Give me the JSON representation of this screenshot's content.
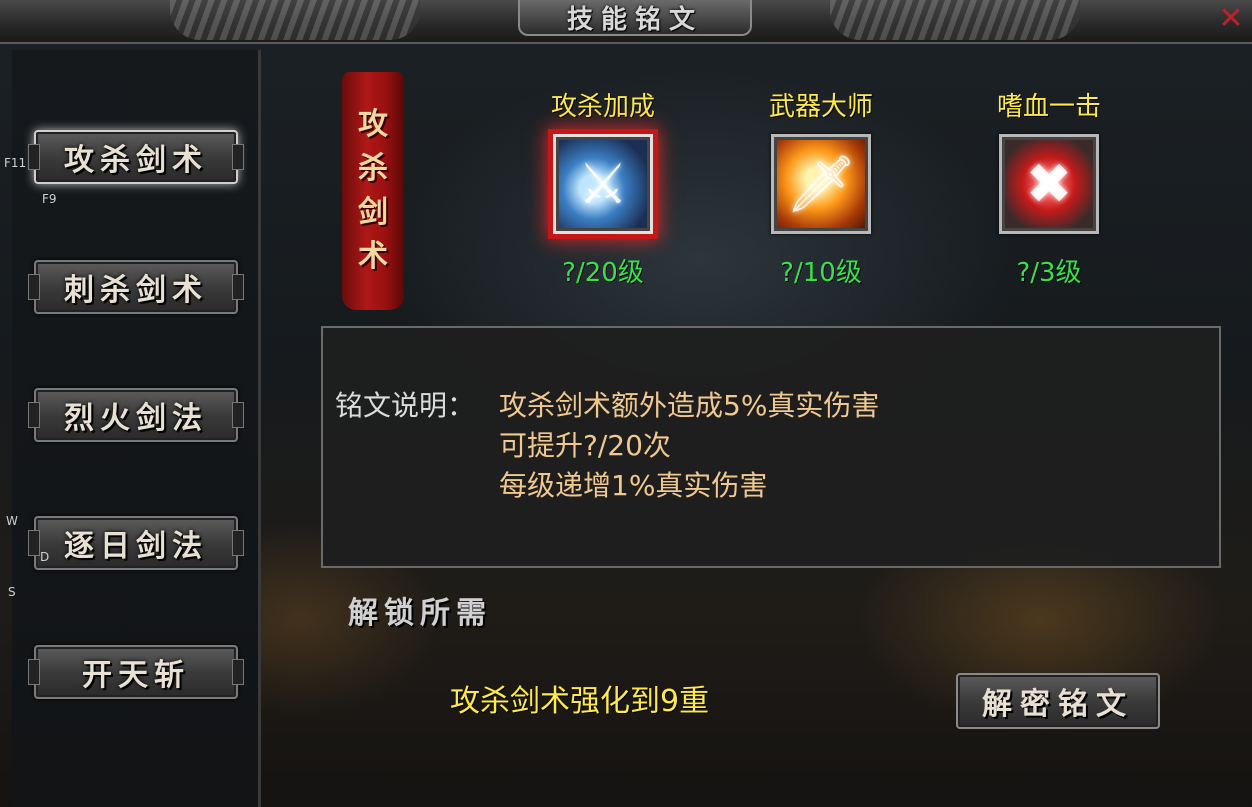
{
  "window": {
    "title": "技能铭文"
  },
  "hotkeys": {
    "f11": "F11",
    "f9": "F9",
    "w": "W",
    "d": "D",
    "s": "S"
  },
  "sidebar": {
    "items": [
      {
        "label": "攻杀剑术",
        "active": true
      },
      {
        "label": "刺杀剑术",
        "active": false
      },
      {
        "label": "烈火剑法",
        "active": false
      },
      {
        "label": "逐日剑法",
        "active": false
      },
      {
        "label": "开天斩",
        "active": false
      }
    ]
  },
  "banner": {
    "chars": [
      "攻",
      "杀",
      "剑",
      "术"
    ]
  },
  "skills": [
    {
      "name": "攻杀加成",
      "level": "?/20级",
      "icon": "blue-blade-icon",
      "selected": true
    },
    {
      "name": "武器大师",
      "level": "?/10级",
      "icon": "flaming-sword-icon",
      "selected": false
    },
    {
      "name": "嗜血一击",
      "level": "?/3级",
      "icon": "blood-strike-icon",
      "selected": false
    }
  ],
  "description": {
    "label": "铭文说明：",
    "lines": [
      "攻杀剑术额外造成5%真实伤害",
      "可提升?/20次",
      "每级递增1%真实伤害"
    ]
  },
  "unlock": {
    "title": "解锁所需",
    "requirement": "攻杀剑术强化到9重"
  },
  "decode_button": {
    "label": "解密铭文"
  },
  "colors": {
    "skill_name": "#ffe94a",
    "skill_level": "#36e24a",
    "desc_text": "#f0c890",
    "banner": "#b01818"
  }
}
